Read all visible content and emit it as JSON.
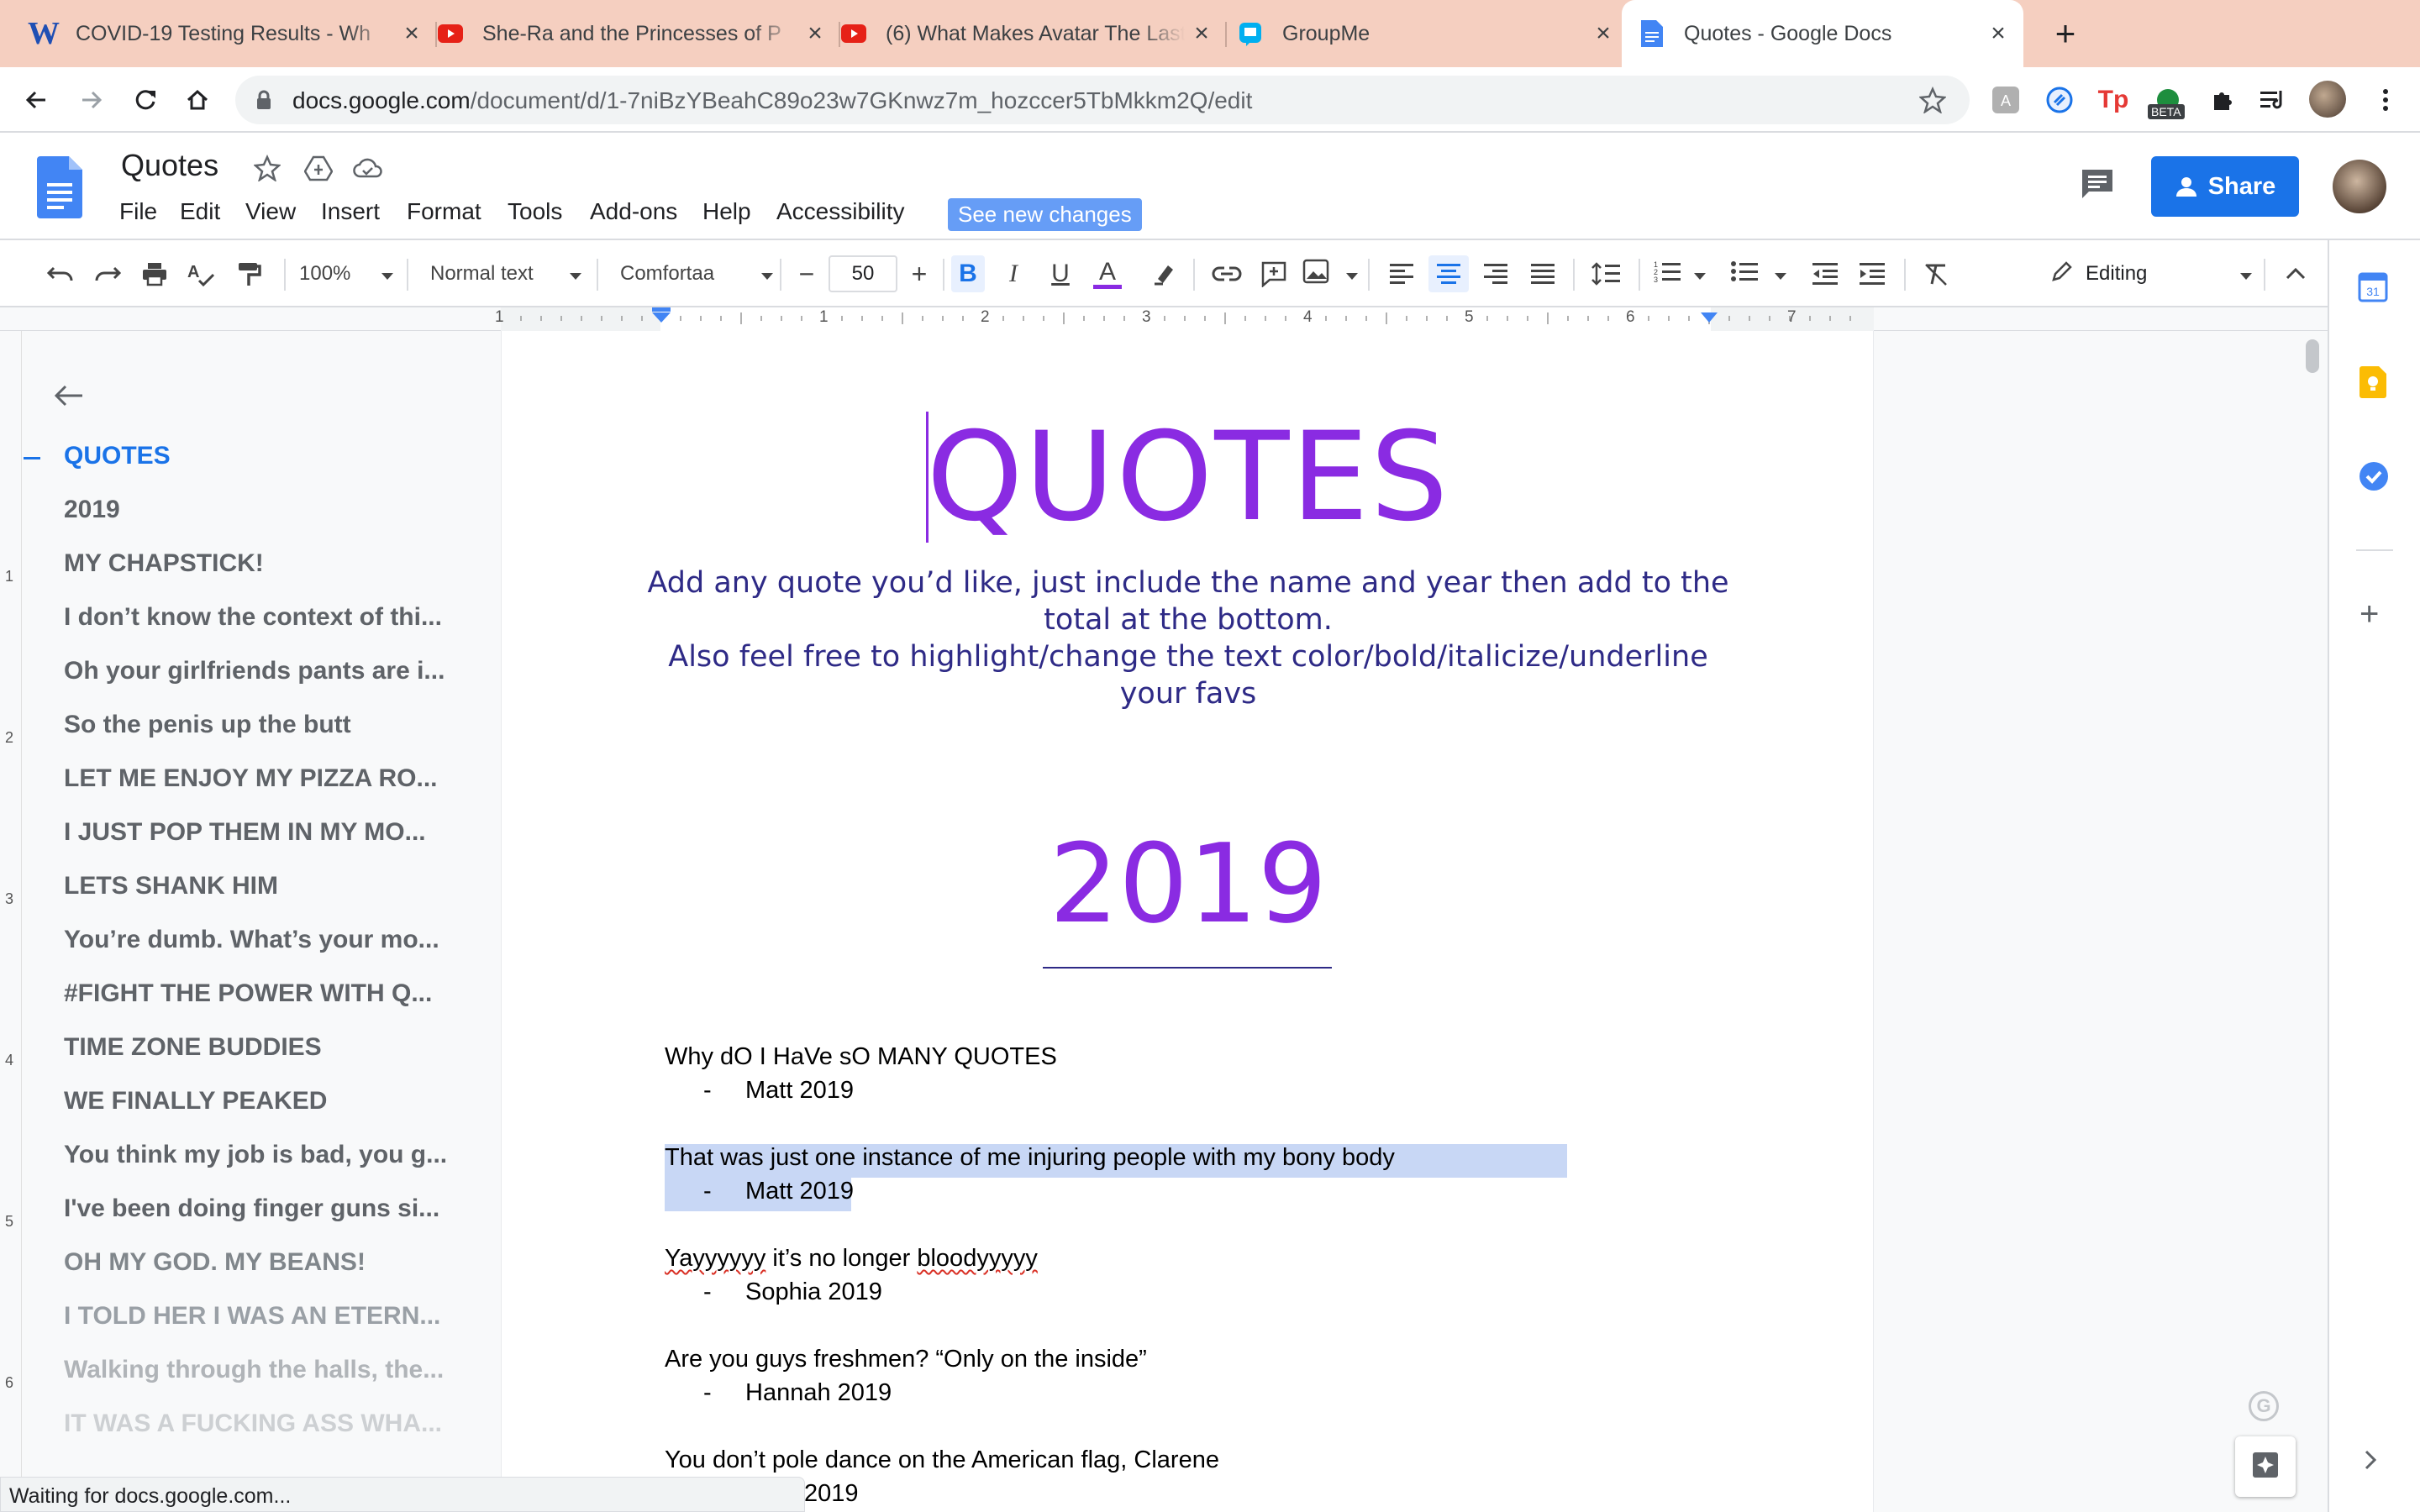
{
  "browser": {
    "tabs": [
      {
        "title": "COVID-19 Testing Results - Wh",
        "icon": "w-icon"
      },
      {
        "title": "She-Ra and the Princesses of P",
        "icon": "youtube-icon"
      },
      {
        "title": "(6) What Makes Avatar The Last",
        "icon": "youtube-icon"
      },
      {
        "title": "GroupMe",
        "icon": "groupme-icon"
      },
      {
        "title": "Quotes - Google Docs",
        "icon": "docs-icon"
      }
    ],
    "url_host": "docs.google.com",
    "url_path": "/document/d/1-7niBzYBeahC89o23w7GKnwz7m_hozccer5TbMkkm2Q/edit",
    "extension_badge": "BETA",
    "status": "Waiting for docs.google.com..."
  },
  "docs": {
    "title": "Quotes",
    "menu": [
      "File",
      "Edit",
      "View",
      "Insert",
      "Format",
      "Tools",
      "Add-ons",
      "Help",
      "Accessibility"
    ],
    "see_changes": "See new changes",
    "share_label": "Share",
    "toolbar": {
      "zoom": "100%",
      "style": "Normal text",
      "font": "Comfortaa",
      "font_size": "50",
      "mode": "Editing"
    },
    "ruler_numbers": [
      "1",
      "1",
      "2",
      "3",
      "4",
      "5",
      "6",
      "7"
    ],
    "left_ruler_numbers": [
      "1",
      "2",
      "3",
      "4",
      "5",
      "6"
    ]
  },
  "outline": [
    {
      "text": "QUOTES",
      "active": true
    },
    {
      "text": "2019"
    },
    {
      "text": "MY CHAPSTICK!"
    },
    {
      "text": "I don’t know the context of thi..."
    },
    {
      "text": "Oh your girlfriends pants are i..."
    },
    {
      "text": "So the penis up the butt"
    },
    {
      "text": "LET ME ENJOY MY PIZZA RO..."
    },
    {
      "text": "I JUST POP THEM IN MY MO..."
    },
    {
      "text": "LETS SHANK HIM"
    },
    {
      "text": "You’re dumb. What’s your mo..."
    },
    {
      "text": "#FIGHT THE POWER WITH Q..."
    },
    {
      "text": "TIME ZONE BUDDIES"
    },
    {
      "text": "WE FINALLY PEAKED"
    },
    {
      "text": "You think my job is bad, you g..."
    },
    {
      "text": "I've been doing finger guns si..."
    },
    {
      "text": "OH MY GOD. MY BEANS!"
    },
    {
      "text": "I TOLD HER I WAS AN ETERN..."
    },
    {
      "text": "Walking through the halls, the..."
    },
    {
      "text": "IT WAS A FUCKING ASS WHA..."
    }
  ],
  "document": {
    "heading": "QUOTES",
    "intro": [
      "Add any quote you’d like, just include the name and year then add to the",
      "total at the bottom.",
      "Also feel free to highlight/change the text color/bold/italicize/underline",
      "your favs"
    ],
    "year_heading": "2019",
    "quotes": [
      {
        "text": "Why dO I HaVe sO MANY QUOTES",
        "author": "Matt 2019"
      },
      {
        "text": "That was just one instance of me injuring people with my bony body",
        "author": "Matt 2019"
      },
      {
        "text_a": "Yayyyyyy",
        "text_b": " it’s no longer ",
        "text_c": "bloodyyyyy",
        "author": "Sophia 2019"
      },
      {
        "text": "Are you guys freshmen? “Only on the inside”",
        "author": "Hannah 2019"
      },
      {
        "text": "You don’t pole dance on the American flag, Clarene",
        "author": "2019"
      }
    ],
    "bullet": "-"
  },
  "colors": {
    "accent_purple": "#8a2be2",
    "intro_navy": "#2e2a86",
    "selection": "#c8d7f5",
    "share_blue": "#1a73e8",
    "outline_active": "#1a73e8"
  }
}
